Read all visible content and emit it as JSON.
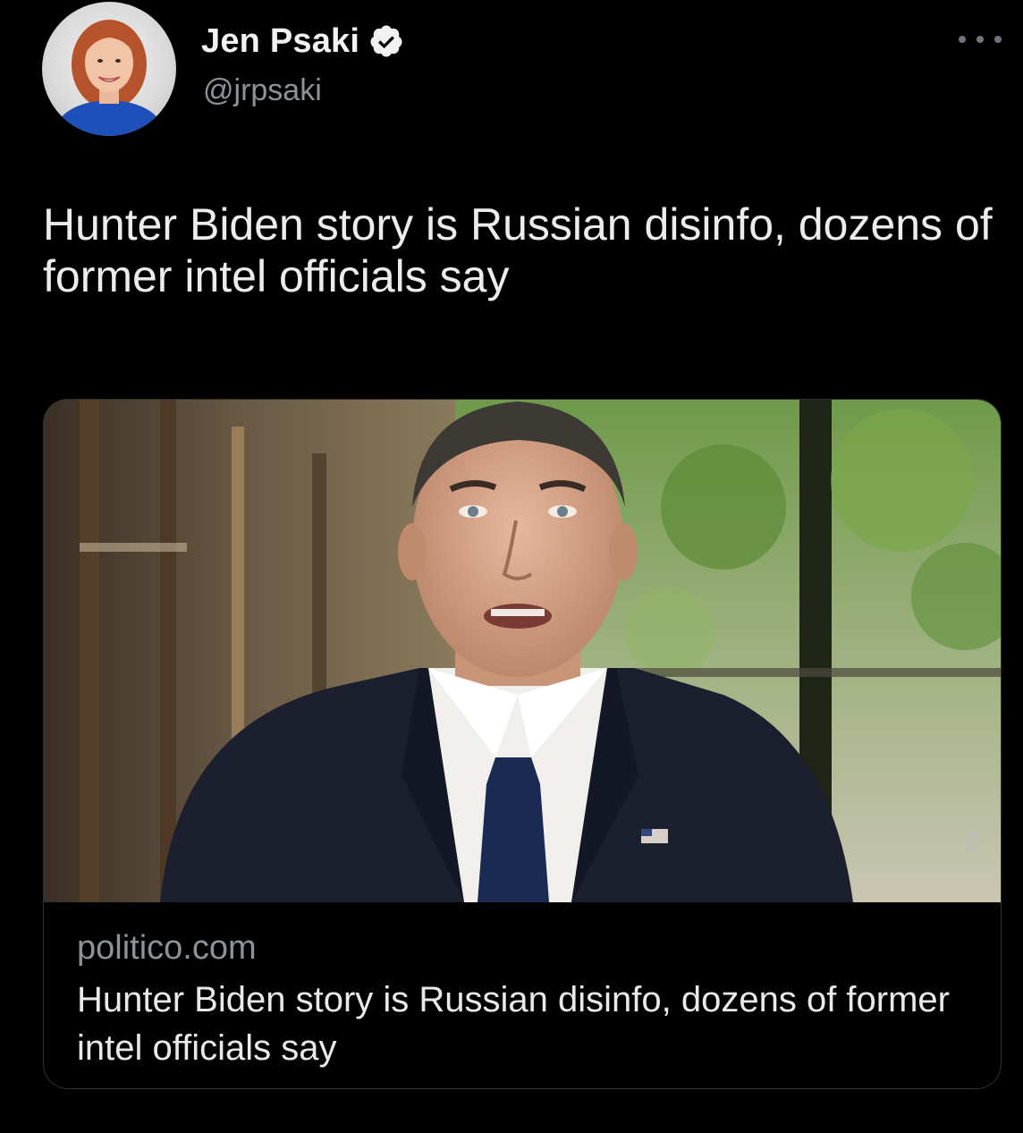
{
  "tweet": {
    "author": {
      "display_name": "Jen Psaki",
      "handle": "@jrpsaki",
      "verified": true,
      "avatar_icon": "profile-photo"
    },
    "more_icon": "more-horizontal-icon",
    "text": "Hunter Biden story is Russian disinfo, dozens of former intel officials say",
    "card": {
      "domain": "politico.com",
      "title": "Hunter Biden story is Russian disinfo, dozens of former intel officials say",
      "image": "photo of a man in a dark suit speaking in front of a blurred green background"
    }
  },
  "colors": {
    "background": "#000000",
    "primary_text": "#e7e9ea",
    "secondary_text": "#8b9399",
    "card_border": "#2f3336",
    "verified_badge": "#f2f2f2"
  }
}
